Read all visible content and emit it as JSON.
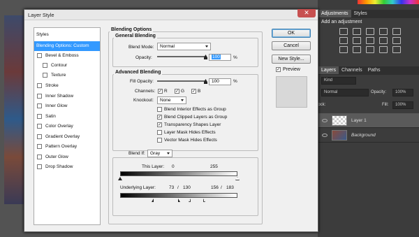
{
  "dialog": {
    "title": "Layer Style",
    "close_glyph": "✕",
    "styles_header": "Styles",
    "styles": [
      {
        "label": "Blending Options: Custom",
        "selected": true,
        "checkbox": false,
        "sub": false
      },
      {
        "label": "Bevel & Emboss",
        "checkbox": true,
        "sub": false
      },
      {
        "label": "Contour",
        "checkbox": true,
        "sub": true
      },
      {
        "label": "Texture",
        "checkbox": true,
        "sub": true
      },
      {
        "label": "Stroke",
        "checkbox": true,
        "sub": false
      },
      {
        "label": "Inner Shadow",
        "checkbox": true,
        "sub": false
      },
      {
        "label": "Inner Glow",
        "checkbox": true,
        "sub": false
      },
      {
        "label": "Satin",
        "checkbox": true,
        "sub": false
      },
      {
        "label": "Color Overlay",
        "checkbox": true,
        "sub": false
      },
      {
        "label": "Gradient Overlay",
        "checkbox": true,
        "sub": false
      },
      {
        "label": "Pattern Overlay",
        "checkbox": true,
        "sub": false
      },
      {
        "label": "Outer Glow",
        "checkbox": true,
        "sub": false
      },
      {
        "label": "Drop Shadow",
        "checkbox": true,
        "sub": false
      }
    ],
    "blending_options": {
      "title": "Blending Options",
      "general": {
        "title": "General Blending",
        "blend_mode_label": "Blend Mode:",
        "blend_mode_value": "Normal",
        "opacity_label": "Opacity:",
        "opacity_value": "100",
        "percent": "%"
      },
      "advanced": {
        "title": "Advanced Blending",
        "fill_opacity_label": "Fill Opacity:",
        "fill_opacity_value": "100",
        "percent": "%",
        "channels_label": "Channels:",
        "channel_r": "R",
        "channel_g": "G",
        "channel_b": "B",
        "knockout_label": "Knockout:",
        "knockout_value": "None",
        "options": [
          {
            "label": "Blend Interior Effects as Group",
            "checked": false
          },
          {
            "label": "Blend Clipped Layers as Group",
            "checked": true
          },
          {
            "label": "Transparency Shapes Layer",
            "checked": true
          },
          {
            "label": "Layer Mask Hides Effects",
            "checked": false
          },
          {
            "label": "Vector Mask Hides Effects",
            "checked": false
          }
        ],
        "check_glyph": "✓"
      },
      "blend_if": {
        "label": "Blend If:",
        "value": "Gray",
        "this_layer_label": "This Layer:",
        "this_layer_low": "0",
        "this_layer_high": "255",
        "underlying_label": "Underlying Layer:",
        "underlying_low": "73",
        "underlying_sep1": "/",
        "underlying_low2": "130",
        "underlying_high": "156",
        "underlying_sep2": "/",
        "underlying_high2": "183"
      }
    },
    "buttons": {
      "ok": "OK",
      "cancel": "Cancel",
      "new_style": "New Style...",
      "preview": "Preview"
    }
  },
  "panels": {
    "adjustments_tab": "Adjustments",
    "styles_tab": "Styles",
    "add_adjustment": "Add an adjustment",
    "layers_tab": "Layers",
    "channels_tab": "Channels",
    "paths_tab": "Paths",
    "kind_value": "Kind",
    "blend_value": "Normal",
    "opacity_label": "Opacity:",
    "opacity_value": "100%",
    "lock_label": "Lock:",
    "fill_label": "Fill:",
    "fill_value": "100%",
    "layers": [
      {
        "name": "Layer 1",
        "selected": true,
        "italic": false
      },
      {
        "name": "Background",
        "selected": false,
        "italic": true
      }
    ]
  }
}
